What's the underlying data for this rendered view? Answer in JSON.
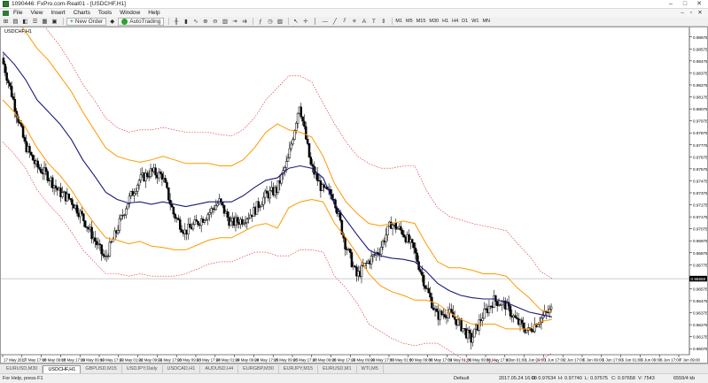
{
  "window": {
    "title": "1090446: FxPro.com-Real01 - [USDCHF,H1]",
    "controls": [
      "–",
      "□",
      "✕"
    ]
  },
  "menu": {
    "items": [
      "File",
      "View",
      "Insert",
      "Charts",
      "Tools",
      "Window",
      "Help"
    ],
    "mdi_controls": [
      "–",
      "▫",
      "✕"
    ]
  },
  "toolbar": {
    "new_order": "New Order",
    "autotrading": "AutoTrading",
    "periods": [
      "M1",
      "M5",
      "M15",
      "M30",
      "H1",
      "H4",
      "D1",
      "W1",
      "MN"
    ]
  },
  "chart": {
    "label": "USDCHF,H1",
    "price_label": "0.96659",
    "colors": {
      "candle": "#000000",
      "middle_band": "#1a1a7e",
      "inner_band": "#ff9900",
      "outer_band": "#e02020",
      "price_line": "#9a9a9a",
      "price_tag_bg": "#000000"
    }
  },
  "chart_data": {
    "type": "line",
    "title": "USDCHF,H1",
    "y_ticks": [
      "0.98675",
      "0.98575",
      "0.98475",
      "0.98375",
      "0.98275",
      "0.98175",
      "0.98075",
      "0.97975",
      "0.97875",
      "0.97775",
      "0.97675",
      "0.97575",
      "0.97475",
      "0.97375",
      "0.97275",
      "0.97175",
      "0.97075",
      "0.96975",
      "0.96875",
      "0.96775",
      "0.96675",
      "0.96575",
      "0.96475",
      "0.96375",
      "0.96275",
      "0.96175",
      "0.96075"
    ],
    "x_ticks": [
      "17 May 2017",
      "17 May 17:00",
      "18 May 09:00",
      "18 May 17:00",
      "19 May 09:00",
      "19 May 17:00",
      "22 May 01:00",
      "22 May 09:00",
      "22 May 17:00",
      "23 May 09:00",
      "23 May 17:00",
      "24 May 01:00",
      "24 May 09:00",
      "24 May 17:00",
      "25 May 09:00",
      "25 May 17:00",
      "26 May 09:00",
      "26 May 17:00",
      "29 May 09:00",
      "29 May 17:00",
      "30 May 01:00",
      "30 May 09:00",
      "30 May 17:00",
      "31 May 01:00",
      "31 May 09:00",
      "31 May 17:00",
      "1 Jun 01:00",
      "1 Jun 09:00",
      "1 Jun 17:00",
      "2 Jun 17:00",
      "5 Jun 09:00",
      "5 Jun 17:00",
      "6 Jun 01:00",
      "6 Jun 09:00",
      "6 Jun 17:00",
      "7 Jun 09:00"
    ],
    "ylim": [
      0.96025,
      0.98725
    ],
    "current_price": 0.96659,
    "series": [
      {
        "values": [
          0.985,
          0.9815,
          0.9778,
          0.976,
          0.9752,
          0.9738,
          0.9732,
          0.9718,
          0.97,
          0.9682,
          0.9705,
          0.973,
          0.9748,
          0.9755,
          0.9752,
          0.972,
          0.9705,
          0.9712,
          0.972,
          0.973,
          0.9712,
          0.9715,
          0.9722,
          0.9735,
          0.974,
          0.9765,
          0.9812,
          0.976,
          0.974,
          0.9735,
          0.9695,
          0.9668,
          0.968,
          0.969,
          0.9712,
          0.9705,
          0.969,
          0.966,
          0.9635,
          0.9638,
          0.9628,
          0.9615,
          0.9635,
          0.9648,
          0.9644,
          0.963,
          0.9622,
          0.9632,
          0.964
        ]
      },
      {
        "values": [
          0.9855,
          0.9845,
          0.9832,
          0.9815,
          0.9805,
          0.9795,
          0.9782,
          0.9765,
          0.9752,
          0.9738,
          0.9732,
          0.9729,
          0.973,
          0.9728,
          0.973,
          0.9728,
          0.9726,
          0.9728,
          0.973,
          0.973,
          0.973,
          0.9735,
          0.9742,
          0.9748,
          0.975,
          0.9758,
          0.976,
          0.9758,
          0.975,
          0.9728,
          0.9715,
          0.9702,
          0.969,
          0.9685,
          0.9683,
          0.9682,
          0.968,
          0.9672,
          0.9662,
          0.9656,
          0.9652,
          0.965,
          0.9649,
          0.9649,
          0.9646,
          0.9642,
          0.9638,
          0.9636,
          0.9634
        ]
      },
      {
        "values": [
          0.9895,
          0.9885,
          0.9872,
          0.9858,
          0.9848,
          0.9835,
          0.9822,
          0.9805,
          0.979,
          0.9775,
          0.9768,
          0.9765,
          0.9763,
          0.9765,
          0.9768,
          0.9765,
          0.9762,
          0.9762,
          0.9762,
          0.976,
          0.976,
          0.9765,
          0.9775,
          0.9788,
          0.9795,
          0.979,
          0.9788,
          0.9784,
          0.9768,
          0.9745,
          0.973,
          0.972,
          0.9712,
          0.971,
          0.9712,
          0.9714,
          0.9712,
          0.9695,
          0.968,
          0.9675,
          0.9675,
          0.9673,
          0.967,
          0.967,
          0.9668,
          0.9658,
          0.965,
          0.964,
          0.9638
        ]
      },
      {
        "values": [
          0.9815,
          0.9805,
          0.9792,
          0.9775,
          0.9762,
          0.9752,
          0.974,
          0.9725,
          0.9712,
          0.97,
          0.9698,
          0.9695,
          0.9697,
          0.9693,
          0.9692,
          0.969,
          0.969,
          0.9694,
          0.9698,
          0.97,
          0.97,
          0.9705,
          0.971,
          0.9712,
          0.9708,
          0.9725,
          0.973,
          0.9732,
          0.973,
          0.9712,
          0.97,
          0.9686,
          0.967,
          0.966,
          0.9655,
          0.9652,
          0.9648,
          0.9648,
          0.9645,
          0.9638,
          0.9632,
          0.9628,
          0.9628,
          0.9628,
          0.9624,
          0.9624,
          0.9624,
          0.963,
          0.9632
        ]
      },
      {
        "values": [
          0.993,
          0.992,
          0.9905,
          0.9885,
          0.9872,
          0.986,
          0.9845,
          0.9828,
          0.9815,
          0.98,
          0.9792,
          0.9788,
          0.979,
          0.979,
          0.9792,
          0.979,
          0.9788,
          0.9788,
          0.9788,
          0.9786,
          0.9785,
          0.979,
          0.98,
          0.9815,
          0.9825,
          0.9835,
          0.9835,
          0.983,
          0.9812,
          0.9795,
          0.978,
          0.9768,
          0.9762,
          0.9758,
          0.9758,
          0.976,
          0.976,
          0.974,
          0.9725,
          0.9718,
          0.9715,
          0.9712,
          0.971,
          0.9708,
          0.9706,
          0.9695,
          0.9685,
          0.9672,
          0.9666
        ]
      },
      {
        "values": [
          0.978,
          0.977,
          0.9758,
          0.974,
          0.9728,
          0.9718,
          0.9705,
          0.969,
          0.968,
          0.967,
          0.967,
          0.9668,
          0.967,
          0.9668,
          0.9668,
          0.9668,
          0.967,
          0.9674,
          0.9678,
          0.968,
          0.968,
          0.9684,
          0.9688,
          0.9688,
          0.9685,
          0.9685,
          0.969,
          0.969,
          0.9688,
          0.9668,
          0.9658,
          0.9645,
          0.9628,
          0.9622,
          0.9616,
          0.9612,
          0.961,
          0.9612,
          0.9612,
          0.9606,
          0.96,
          0.9594,
          0.9594,
          0.9598,
          0.9592,
          0.9593,
          0.9594,
          0.9598,
          0.9604
        ]
      }
    ]
  },
  "tabs": [
    "EURUSD,M30",
    "USDCHF,H1",
    "GBPUSD,M15",
    "USDJPY,Daily",
    "USDCAD,H1",
    "AUDUSD,H4",
    "EURGBP,M30",
    "EURJPY,M15",
    "EURUSD,M1",
    "WTI,M5"
  ],
  "active_tab": 1,
  "status": {
    "help": "For Help, press F1",
    "profile": "Default",
    "datetime": "2017.05.24 16:00",
    "open": "O: 0.97634",
    "high": "H: 0.97740",
    "low": "L: 0.97575",
    "close": "C: 0.97658",
    "volume": "V: 7543",
    "traffic": "6559/4 kb"
  }
}
